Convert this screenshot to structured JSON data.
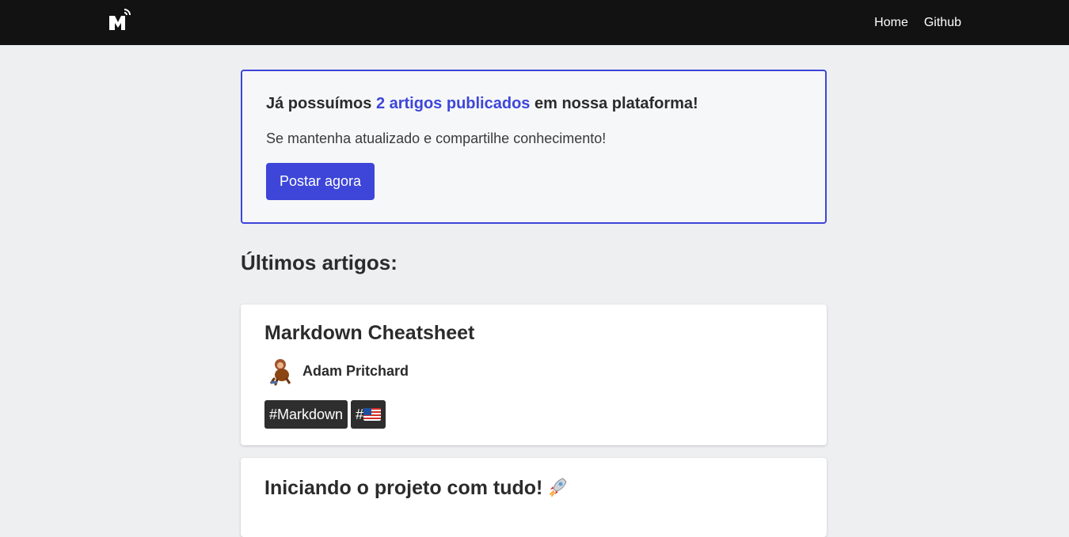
{
  "nav": {
    "logo_icon": "m-logo-icon",
    "links": [
      "Home",
      "Github"
    ]
  },
  "hero": {
    "title_before": "Já possuímos ",
    "title_highlight": "2 artigos publicados",
    "title_after": " em nossa plataforma!",
    "subtitle": "Se mantenha atualizado e compartilhe conhecimento!",
    "button_label": "Postar agora"
  },
  "latest": {
    "heading": "Últimos artigos:",
    "articles": [
      {
        "title": "Markdown Cheatsheet",
        "author": "Adam Pritchard",
        "tags": [
          "#Markdown",
          "#"
        ],
        "tag_icons": [
          "",
          "us-flag-icon"
        ]
      },
      {
        "title": "Iniciando o projeto com tudo!",
        "title_icon": "rocket-icon"
      }
    ]
  },
  "colors": {
    "accent": "#3d46d8",
    "navbar": "#121212",
    "tag_bg": "#2e2e2e"
  }
}
